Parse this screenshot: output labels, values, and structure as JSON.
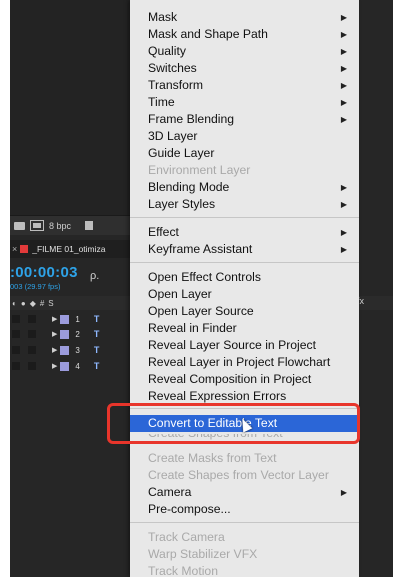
{
  "project_panel": {
    "bpc_label": "8 bpc"
  },
  "timeline": {
    "tab_label": "_FILME 01_otimiza",
    "tab_close": "×",
    "timecode": ":00:00:03",
    "frame_info": "003 (29.97 fps)",
    "search_glyph": "ρ.",
    "header_hash": "#",
    "header_source": "S",
    "layers": [
      {
        "number": "1"
      },
      {
        "number": "2"
      },
      {
        "number": "3"
      },
      {
        "number": "4"
      }
    ],
    "switch_header": "\\ fx",
    "switch_mark": "/"
  },
  "menu": {
    "group1": [
      {
        "label": "Mask",
        "arrow": "▶"
      },
      {
        "label": "Mask and Shape Path",
        "arrow": "▶"
      },
      {
        "label": "Quality",
        "arrow": "▶"
      },
      {
        "label": "Switches",
        "arrow": "▶"
      },
      {
        "label": "Transform",
        "arrow": "▶"
      },
      {
        "label": "Time",
        "arrow": "▶"
      },
      {
        "label": "Frame Blending",
        "arrow": "▶"
      },
      {
        "label": "3D Layer"
      },
      {
        "label": "Guide Layer"
      },
      {
        "label": "Environment Layer",
        "disabled": true
      },
      {
        "label": "Blending Mode",
        "arrow": "▶"
      },
      {
        "label": "Layer Styles",
        "arrow": "▶"
      }
    ],
    "group2": [
      {
        "label": "Effect",
        "arrow": "▶"
      },
      {
        "label": "Keyframe Assistant",
        "arrow": "▶"
      }
    ],
    "group3": [
      {
        "label": "Open Effect Controls"
      },
      {
        "label": "Open Layer"
      },
      {
        "label": "Open Layer Source"
      },
      {
        "label": "Reveal in Finder"
      },
      {
        "label": "Reveal Layer Source in Project"
      },
      {
        "label": "Reveal Layer in Project Flowchart"
      },
      {
        "label": "Reveal Composition in Project"
      },
      {
        "label": "Reveal Expression Errors"
      }
    ],
    "highlighted": {
      "label": "Convert to Editable Text"
    },
    "partially_hidden": {
      "label": "Create Shapes from Text"
    },
    "group4": [
      {
        "label": "Create Masks from Text",
        "disabled": true
      },
      {
        "label": "Create Shapes from Vector Layer",
        "disabled": true
      },
      {
        "label": "Camera",
        "arrow": "▶"
      },
      {
        "label": "Pre-compose..."
      }
    ],
    "group5": [
      {
        "label": "Track Camera",
        "disabled": true
      },
      {
        "label": "Warp Stabilizer VFX",
        "disabled": true
      },
      {
        "label": "Track Motion",
        "disabled": true
      }
    ]
  },
  "colors": {
    "menu_bg": "#e8e8e8",
    "highlight_bg": "#2b66d7",
    "annotation_red": "#e8352b",
    "timecode_blue": "#2ea3e8"
  }
}
